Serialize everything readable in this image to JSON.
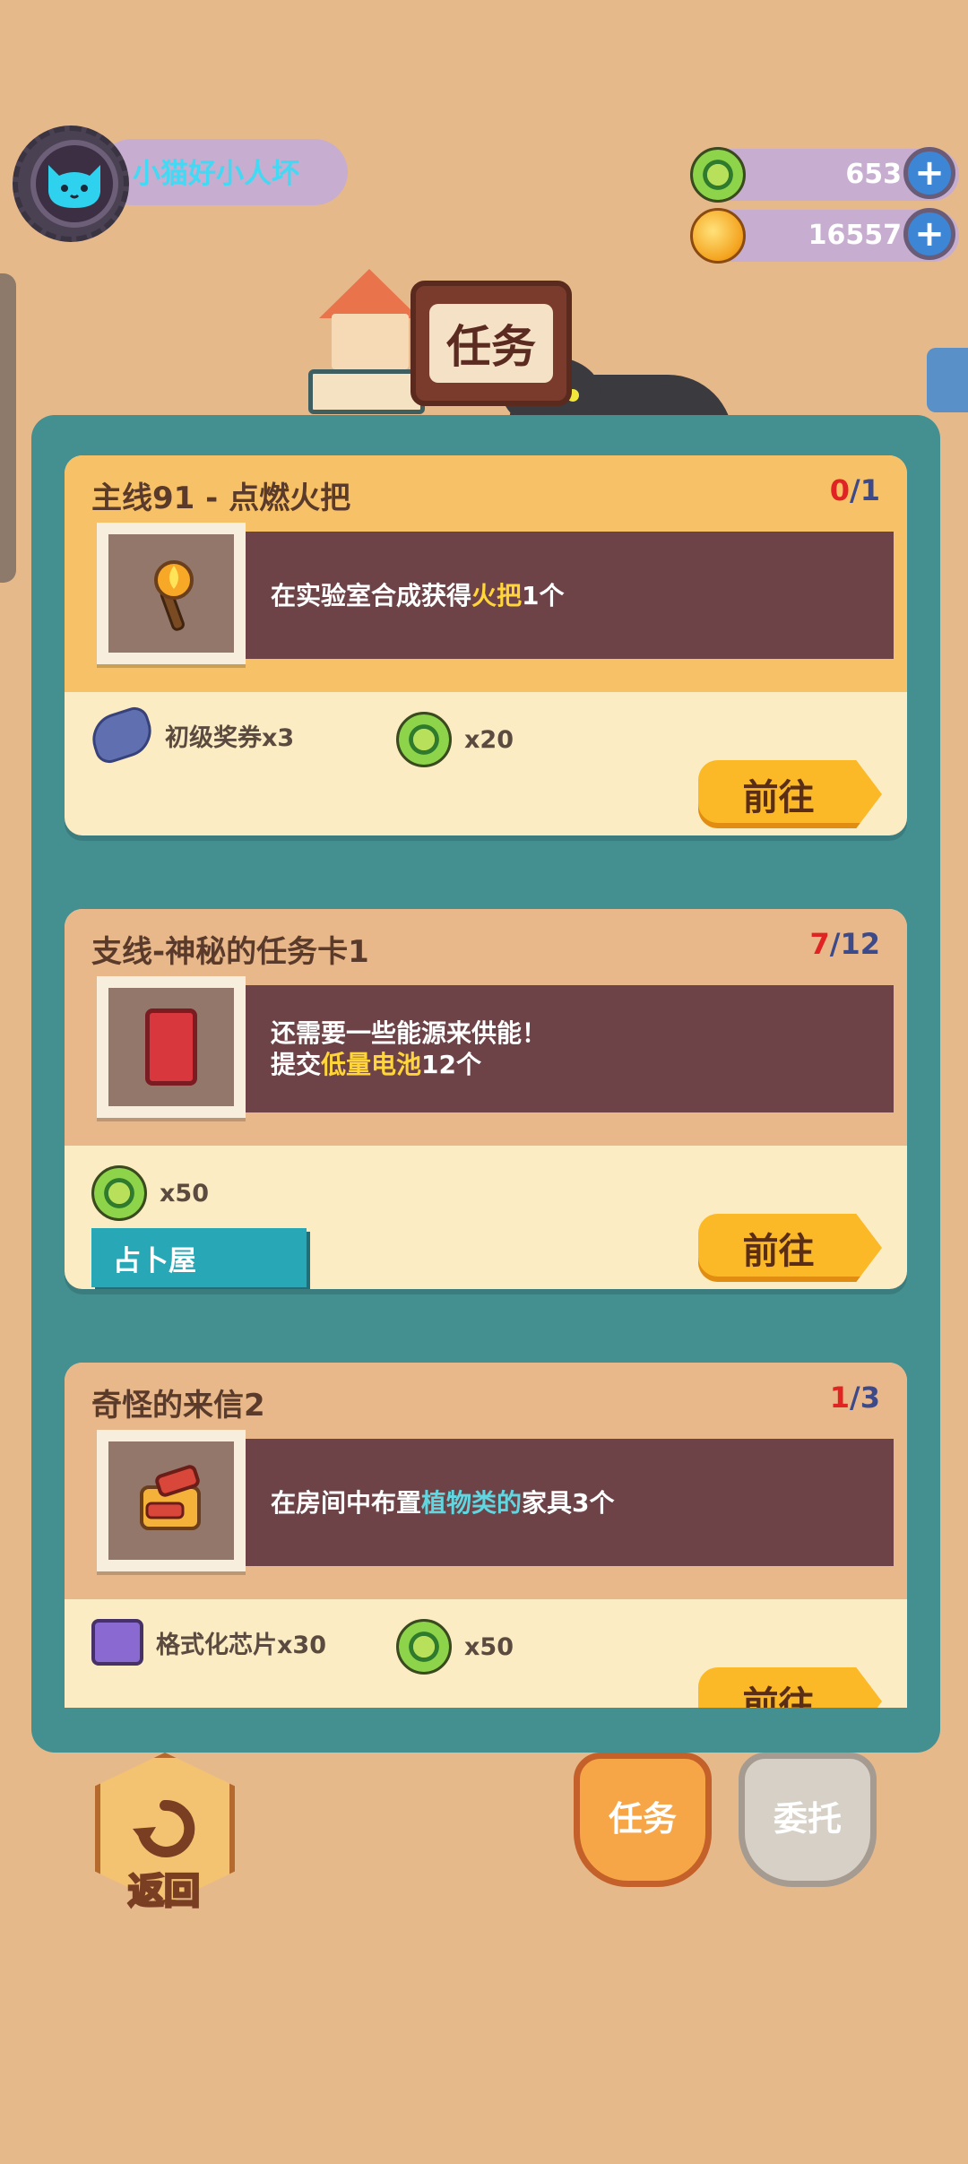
{
  "player": {
    "name": "小猫好小人坏"
  },
  "currencies": [
    {
      "icon": "green-gem-coin-icon",
      "value": "653"
    },
    {
      "icon": "gold-planet-coin-icon",
      "value": "16557"
    }
  ],
  "header": {
    "title": "任务"
  },
  "tasks": [
    {
      "title": "主线91 - 点燃火把",
      "progress_current": "0",
      "progress_total": "/1",
      "desc_prefix": "在实验室合成获得",
      "desc_highlight": "火把",
      "desc_suffix": "1个",
      "icon": "torch-icon",
      "rewards": [
        {
          "icon": "ticket-icon",
          "label": "初级奖券x3"
        },
        {
          "icon": "green-gem-coin-icon",
          "label": "x20"
        }
      ],
      "button": "前往"
    },
    {
      "title": "支线-神秘的任务卡1",
      "progress_current": "7",
      "progress_total": "/12",
      "desc_line1": "还需要一些能源来供能！",
      "desc_prefix": "提交",
      "desc_highlight": "低量电池",
      "desc_suffix": "12个",
      "icon": "battery-icon",
      "rewards": [
        {
          "icon": "green-gem-coin-icon",
          "label": "x50"
        }
      ],
      "tag": "占卜屋",
      "button": "前往"
    },
    {
      "title": "奇怪的来信2",
      "progress_current": "1",
      "progress_total": "/3",
      "desc_prefix": "在房间中布置",
      "desc_highlight": "植物类的",
      "desc_suffix": "家具3个",
      "icon": "furniture-icon",
      "rewards": [
        {
          "icon": "chip-icon",
          "label": "格式化芯片x30"
        },
        {
          "icon": "green-gem-coin-icon",
          "label": "x50"
        }
      ],
      "button": "前往"
    }
  ],
  "bottom": {
    "back": "返回",
    "tab_tasks": "任务",
    "tab_commission": "委托"
  }
}
